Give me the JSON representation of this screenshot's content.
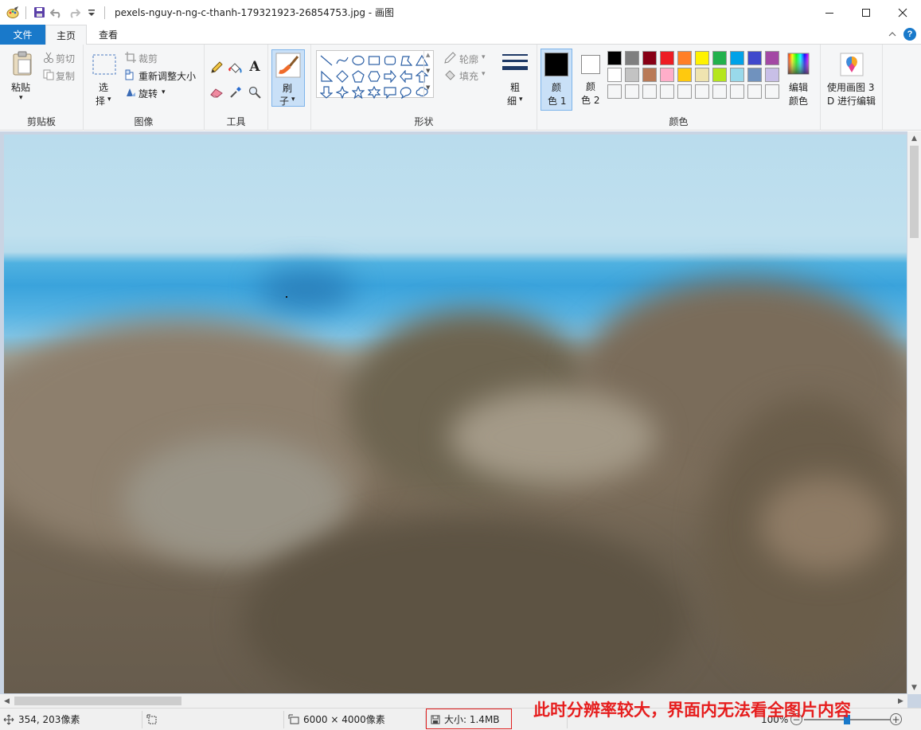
{
  "window": {
    "title": "pexels-nguy-n-ng-c-thanh-179321923-26854753.jpg - 画图",
    "quick_access": [
      "paint-icon",
      "save-icon",
      "undo-icon",
      "redo-icon",
      "customize-icon"
    ]
  },
  "tabs": {
    "file": "文件",
    "home": "主页",
    "view": "查看"
  },
  "ribbon": {
    "clipboard": {
      "paste": "粘贴",
      "cut": "剪切",
      "copy": "复制",
      "label": "剪贴板"
    },
    "image": {
      "select_line1": "选",
      "select_line2": "择",
      "crop": "裁剪",
      "resize": "重新调整大小",
      "rotate": "旋转",
      "label": "图像"
    },
    "tools": {
      "label": "工具"
    },
    "brushes": {
      "line1": "刷",
      "line2": "子"
    },
    "shapes": {
      "outline": "轮廓",
      "fill": "填充",
      "label": "形状"
    },
    "size": {
      "line1": "粗",
      "line2": "细"
    },
    "colors": {
      "color1_line1": "颜",
      "color1_line2": "色 1",
      "color2_line1": "颜",
      "color2_line2": "色 2",
      "edit_line1": "编辑",
      "edit_line2": "颜色",
      "label": "颜色",
      "color1_value": "#000000",
      "color2_value": "#ffffff",
      "palette": [
        "#000000",
        "#7f7f7f",
        "#880015",
        "#ed1c24",
        "#ff7f27",
        "#fff200",
        "#22b14c",
        "#00a2e8",
        "#3f48cc",
        "#a349a4",
        "#ffffff",
        "#c3c3c3",
        "#b97a57",
        "#ffaec9",
        "#ffc90e",
        "#efe4b0",
        "#b5e61d",
        "#99d9ea",
        "#7092be",
        "#c8bfe7",
        "#f5f6f7",
        "#f5f6f7",
        "#f5f6f7",
        "#f5f6f7",
        "#f5f6f7",
        "#f5f6f7",
        "#f5f6f7",
        "#f5f6f7",
        "#f5f6f7",
        "#f5f6f7"
      ]
    },
    "paint3d": {
      "line1": "使用画图 3",
      "line2": "D 进行编辑"
    }
  },
  "status": {
    "cursor_pos": "354, 203像素",
    "dimensions": "6000 × 4000像素",
    "file_size": "大小: 1.4MB",
    "zoom": "100%",
    "zoom_level": 0.5
  },
  "annotation": "此时分辨率较大，界面内无法看全图片内容"
}
